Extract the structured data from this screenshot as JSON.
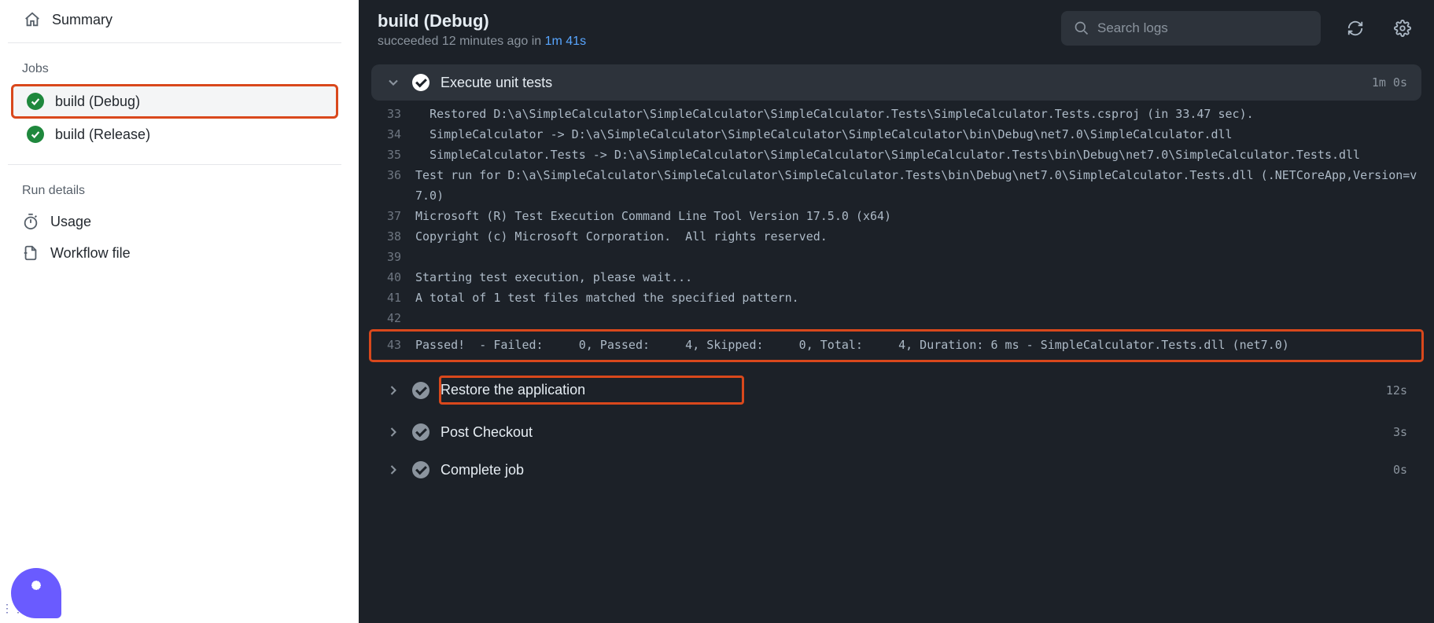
{
  "sidebar": {
    "summary_label": "Summary",
    "jobs_heading": "Jobs",
    "jobs": [
      {
        "label": "build (Debug)"
      },
      {
        "label": "build (Release)"
      }
    ],
    "run_details_heading": "Run details",
    "usage_label": "Usage",
    "workflow_file_label": "Workflow file"
  },
  "header": {
    "title": "build (Debug)",
    "status_prefix": "succeeded",
    "status_time": "12 minutes ago",
    "status_mid": "in",
    "duration": "1m 41s",
    "search_placeholder": "Search logs"
  },
  "steps": {
    "expanded": {
      "label": "Execute unit tests",
      "time": "1m 0s"
    },
    "collapsed": [
      {
        "label": "Restore the application",
        "time": "12s",
        "highlighted": true,
        "skippable": true
      },
      {
        "label": "Post Checkout",
        "time": "3s",
        "highlighted": false,
        "skippable": true
      },
      {
        "label": "Complete job",
        "time": "0s",
        "highlighted": false,
        "skippable": true
      }
    ]
  },
  "log": {
    "lines": [
      {
        "n": 33,
        "t": "  Restored D:\\a\\SimpleCalculator\\SimpleCalculator\\SimpleCalculator.Tests\\SimpleCalculator.Tests.csproj (in 33.47 sec)."
      },
      {
        "n": 34,
        "t": "  SimpleCalculator -> D:\\a\\SimpleCalculator\\SimpleCalculator\\SimpleCalculator\\bin\\Debug\\net7.0\\SimpleCalculator.dll"
      },
      {
        "n": 35,
        "t": "  SimpleCalculator.Tests -> D:\\a\\SimpleCalculator\\SimpleCalculator\\SimpleCalculator.Tests\\bin\\Debug\\net7.0\\SimpleCalculator.Tests.dll"
      },
      {
        "n": 36,
        "t": "Test run for D:\\a\\SimpleCalculator\\SimpleCalculator\\SimpleCalculator.Tests\\bin\\Debug\\net7.0\\SimpleCalculator.Tests.dll (.NETCoreApp,Version=v7.0)"
      },
      {
        "n": 37,
        "t": "Microsoft (R) Test Execution Command Line Tool Version 17.5.0 (x64)"
      },
      {
        "n": 38,
        "t": "Copyright (c) Microsoft Corporation.  All rights reserved."
      },
      {
        "n": 39,
        "t": ""
      },
      {
        "n": 40,
        "t": "Starting test execution, please wait..."
      },
      {
        "n": 41,
        "t": "A total of 1 test files matched the specified pattern."
      },
      {
        "n": 42,
        "t": ""
      }
    ],
    "highlight_line": {
      "n": 43,
      "t": "Passed!  - Failed:     0, Passed:     4, Skipped:     0, Total:     4, Duration: 6 ms - SimpleCalculator.Tests.dll (net7.0)"
    }
  }
}
